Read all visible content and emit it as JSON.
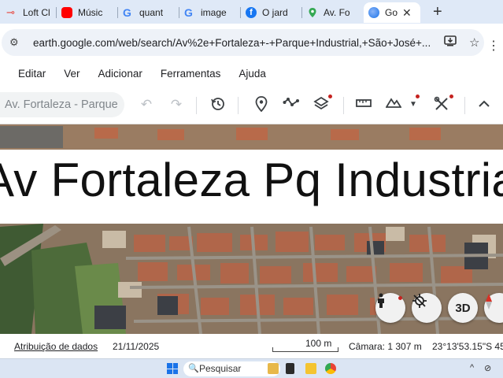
{
  "browser": {
    "tabs": [
      {
        "label": "Loft Cl",
        "icon": "key-icon",
        "color": "#e8453c"
      },
      {
        "label": "Músic",
        "icon": "youtube-icon",
        "color": "#ff0000"
      },
      {
        "label": "quant",
        "icon": "google-icon",
        "color": "#4285f4"
      },
      {
        "label": "image",
        "icon": "google-icon",
        "color": "#4285f4"
      },
      {
        "label": "O jard",
        "icon": "facebook-icon",
        "color": "#1877f2"
      },
      {
        "label": "Av. Fo",
        "icon": "maps-pin-icon",
        "color": "#34a853"
      },
      {
        "label": "Go",
        "icon": "earth-icon",
        "color": "#1a73e8",
        "active": true
      }
    ],
    "close_glyph": "✕",
    "new_tab_glyph": "+",
    "url": "earth.google.com/web/search/Av%2e+Fortaleza+-+Parque+Industrial,+São+José+..."
  },
  "menu": [
    "Editar",
    "Ver",
    "Adicionar",
    "Ferramentas",
    "Ajuda"
  ],
  "earth_toolbar": {
    "search_value": "Av. Fortaleza - Parque"
  },
  "map": {
    "banner_text": "Av Fortaleza Pq Industrial",
    "buttons": {
      "threed_label": "3D"
    }
  },
  "status": {
    "attribution": "Atribuição de dados",
    "date": "21/11/2025",
    "scale": "100 m",
    "camera": "Câmara: 1 307 m",
    "coords": "23°13'53.15\"S 45"
  },
  "taskbar": {
    "search_label": "Pesquisar"
  },
  "colors": {
    "accent": "#1a73e8",
    "tab_strip": "#dfe9f7",
    "notification_dot": "#c5221f"
  }
}
